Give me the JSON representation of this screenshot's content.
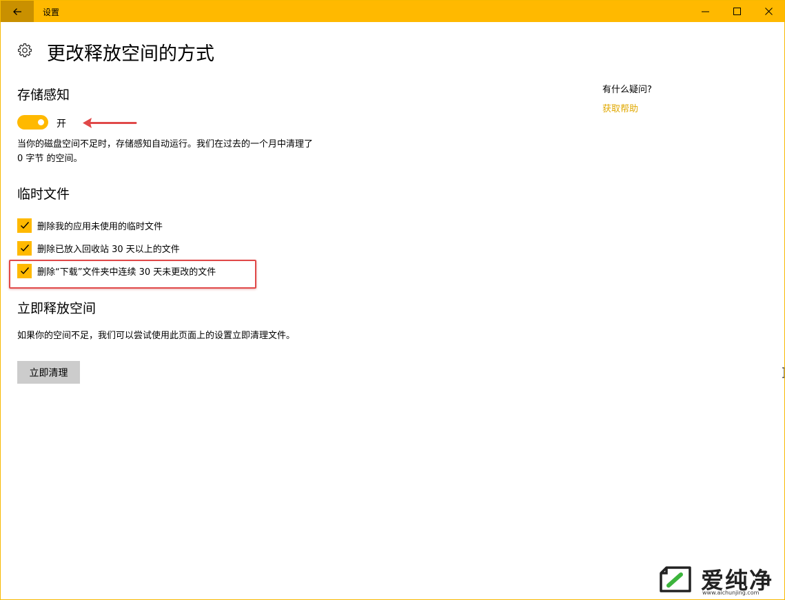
{
  "window": {
    "title": "设置"
  },
  "page": {
    "title": "更改释放空间的方式"
  },
  "storage_sense": {
    "heading": "存储感知",
    "toggle_state": "开",
    "toggle_on": true,
    "description": "当你的磁盘空间不足时，存储感知自动运行。我们在过去的一个月中清理了 0 字节 的空间。"
  },
  "temp_files": {
    "heading": "临时文件",
    "options": [
      {
        "label": "删除我的应用未使用的临时文件",
        "checked": true
      },
      {
        "label": "删除已放入回收站 30 天以上的文件",
        "checked": true
      },
      {
        "label": "删除“下载”文件夹中连续 30 天未更改的文件",
        "checked": true
      }
    ]
  },
  "free_now": {
    "heading": "立即释放空间",
    "description": "如果你的空间不足，我们可以尝试使用此页面上的设置立即清理文件。",
    "button_label": "立即清理"
  },
  "help": {
    "question": "有什么疑问?",
    "link": "获取帮助"
  },
  "watermark": {
    "brand": "爱纯净",
    "url": "www.aichunjing.com"
  },
  "colors": {
    "accent": "#ffb900",
    "back_button": "#c99000",
    "annotation_red": "#e04848",
    "link": "#e0a800"
  }
}
